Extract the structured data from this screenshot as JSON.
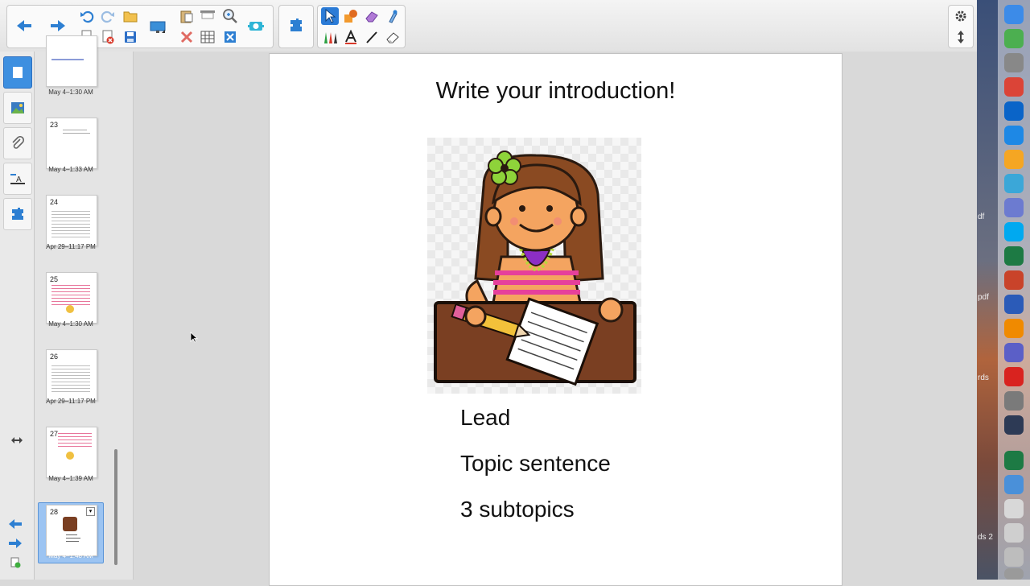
{
  "toolbar": {
    "icons": [
      "back-arrow-icon",
      "forward-arrow-icon",
      "undo-icon",
      "redo-icon",
      "open-folder-icon",
      "add-page-icon",
      "delete-page-icon",
      "save-icon",
      "display-icon",
      "paste-icon",
      "delete-icon",
      "screen-shade-icon",
      "table-icon",
      "zoom-icon",
      "clear-icon",
      "capture-icon",
      "add-ons-icon",
      "select-icon",
      "shapes-icon",
      "eraser-icon",
      "magic-pen-icon",
      "pen-icon",
      "text-icon",
      "line-icon",
      "fill-eraser-icon"
    ]
  },
  "sidetabs": [
    "page-sorter-tab",
    "gallery-tab",
    "attachments-tab",
    "properties-tab",
    "add-ons-tab"
  ],
  "sorter": {
    "pages": [
      {
        "number": "",
        "label": "May 4–1:30 AM"
      },
      {
        "number": "23",
        "label": "May 4–1:33 AM"
      },
      {
        "number": "24",
        "label": "Apr 29–11:17 PM"
      },
      {
        "number": "25",
        "label": "May 4–1:30 AM"
      },
      {
        "number": "26",
        "label": "Apr 29–11:17 PM"
      },
      {
        "number": "27",
        "label": "May 4–1:39 AM"
      },
      {
        "number": "28",
        "label": "May 4–1:48 AM"
      }
    ],
    "selected_page": "28"
  },
  "page": {
    "title": "Write your introduction!",
    "items": [
      "Lead",
      "Topic sentence",
      "3 subtopics"
    ]
  },
  "dock": {
    "fragments": [
      "df",
      "pdf",
      "rds",
      "ds 2"
    ],
    "apps": [
      {
        "name": "finder",
        "color": "#3c8be8"
      },
      {
        "name": "maps",
        "color": "#4caf50"
      },
      {
        "name": "rocket",
        "color": "#888888"
      },
      {
        "name": "chrome",
        "color": "#db4437"
      },
      {
        "name": "outlook",
        "color": "#0a64c8"
      },
      {
        "name": "app-store",
        "color": "#1e88e5"
      },
      {
        "name": "photos",
        "color": "#f5a623"
      },
      {
        "name": "notes",
        "color": "#3ba7d8"
      },
      {
        "name": "airdrop",
        "color": "#6c7bd0"
      },
      {
        "name": "skype",
        "color": "#00a9f0"
      },
      {
        "name": "excel",
        "color": "#1d7a44"
      },
      {
        "name": "powerpoint",
        "color": "#c9432a"
      },
      {
        "name": "word",
        "color": "#2b5bb8"
      },
      {
        "name": "vlc",
        "color": "#f08a00"
      },
      {
        "name": "teams",
        "color": "#5b5fc7"
      },
      {
        "name": "acrobat",
        "color": "#d9231f"
      },
      {
        "name": "system-preferences",
        "color": "#7a7a7a"
      },
      {
        "name": "quicktime",
        "color": "#2d3a55"
      },
      {
        "name": "excel-doc",
        "color": "#1d7a44"
      },
      {
        "name": "mail-at",
        "color": "#4a90d9"
      },
      {
        "name": "document",
        "color": "#d8d8d8"
      },
      {
        "name": "document-2",
        "color": "#cfcfcf"
      },
      {
        "name": "screenshot",
        "color": "#bdbdbd"
      },
      {
        "name": "trash",
        "color": "#9a9a9a"
      }
    ]
  }
}
